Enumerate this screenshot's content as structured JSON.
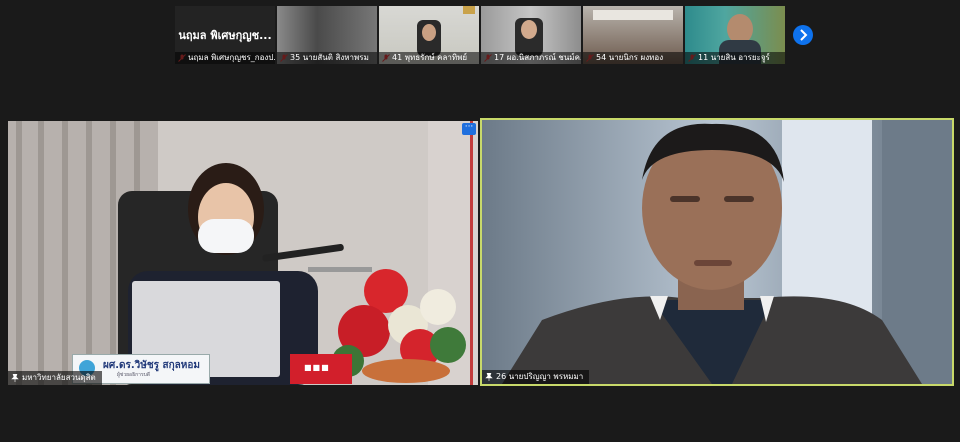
{
  "gallery": {
    "thumbnails": [
      {
        "display_name": "นฤมล  พิเศษกุญช...",
        "label": "นฤมล  พิเศษกุญชร_กองป...",
        "mic": "muted"
      },
      {
        "display_name": "",
        "label": "35 นายสันติ สิงหาพรม",
        "mic": "muted"
      },
      {
        "display_name": "",
        "label": "41 พุทธรักษ์  คลาทิพย์",
        "mic": "muted"
      },
      {
        "display_name": "",
        "label": "17 ผอ.นิสภาภรณ์ ชนม์ค...",
        "mic": "muted"
      },
      {
        "display_name": "",
        "label": "54 นายนิกร ผงทอง",
        "mic": "muted"
      },
      {
        "display_name": "",
        "label": "11 นายสิน  อารยะจูร์",
        "mic": "muted"
      }
    ],
    "next_icon": "chevron-right-icon"
  },
  "main_videos": {
    "left": {
      "name_tag": "มหาวิทยาลัยสวนดุสิต",
      "nameplate_name": "ผศ.ดร.วิษัชรู สกุลหอม",
      "nameplate_sub": "ผู้ช่วยอธิการบดี",
      "more_label": "···"
    },
    "right": {
      "name_tag": "26 นายปริญญา  พรหมมา",
      "active_speaker_color": "#c8d96a"
    }
  }
}
